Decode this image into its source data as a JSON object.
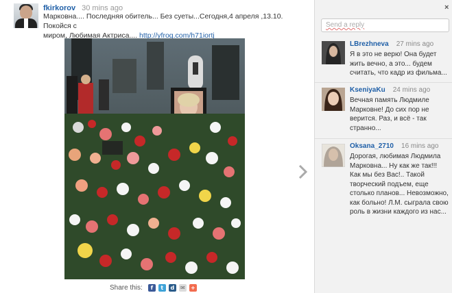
{
  "post": {
    "username": "fkirkorov",
    "time": "30 mins ago",
    "text_line1": "Марковна.... Последняя обитель... Без суеты...Сегодня,4 апреля ,13.10. Покойся с",
    "text_line2": "миром, Любимая Актриса.... ",
    "link": "http://yfrog.com/h71iortj"
  },
  "share": {
    "label": "Share this:",
    "icons": [
      "facebook-icon",
      "twitter-icon",
      "digg-icon",
      "email-icon",
      "addthis-icon"
    ]
  },
  "sidebar": {
    "close": "×",
    "reply_placeholder": "Send a reply",
    "comments": [
      {
        "user": "LBrezhneva",
        "time": "27 mins ago",
        "lines": [
          "Я в это не верю! Она будет",
          "жить вечно, а это... будем",
          "считать, что кадр из фильма..."
        ]
      },
      {
        "user": "KseniyaKu",
        "time": "24 mins ago",
        "lines": [
          "Вечная память Людмиле",
          "Марковне! До сих пор не",
          "верится. Раз, и всё - так",
          "странно..."
        ]
      },
      {
        "user": "Oksana_2710",
        "time": "16 mins ago",
        "lines": [
          "Дорогая, любимая Людмила",
          "Марковна... Ну как же так!!!",
          "Как мы без Вас!.. Такой",
          "творческий подъем, еще",
          "столько планов... Невозможно,",
          "как больно! Л.М. сыграла свою",
          "роль в жизни каждого из нас..."
        ]
      }
    ]
  },
  "colors": {
    "accent": "#1f5fa7",
    "sidebar_bg": "#f2f2f2"
  }
}
